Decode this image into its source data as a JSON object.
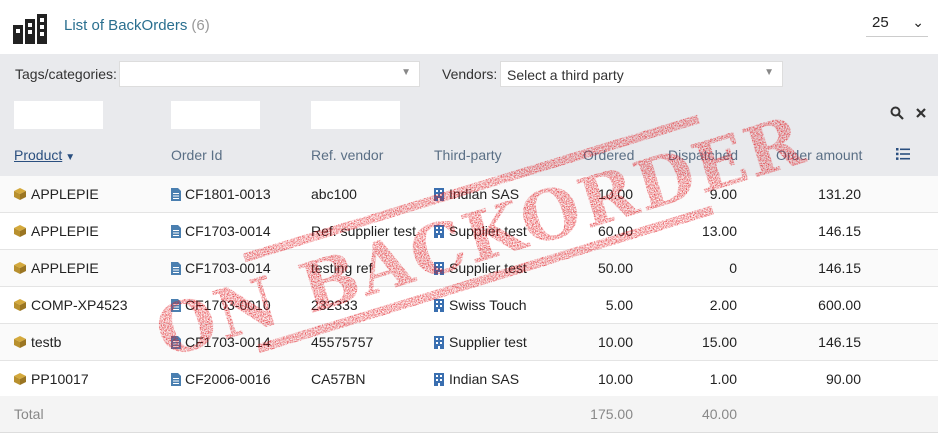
{
  "header": {
    "title": "List of BackOrders",
    "count": "(6)",
    "page_size": "25",
    "icon": "building-icon"
  },
  "filters": {
    "tags_label": "Tags/categories:",
    "tags_value": "",
    "vendors_label": "Vendors:",
    "vendors_placeholder": "Select a third party",
    "search_icon": "search-icon",
    "clear_icon": "close-icon"
  },
  "columns": {
    "product": "Product",
    "order_id": "Order Id",
    "ref_vendor": "Ref. vendor",
    "third_party": "Third-party",
    "ordered": "Ordered",
    "dispatched": "Dispatched",
    "order_amount": "Order amount"
  },
  "rows": [
    {
      "product": "APPLEPIE",
      "order_id": "CF1801-0013",
      "ref": "abc100",
      "third_party": "Indian SAS",
      "ordered": "10.00",
      "dispatched": "9.00",
      "amount": "131.20"
    },
    {
      "product": "APPLEPIE",
      "order_id": "CF1703-0014",
      "ref": "Ref. supplier test",
      "third_party": "Supplier test",
      "ordered": "60.00",
      "dispatched": "13.00",
      "amount": "146.15"
    },
    {
      "product": "APPLEPIE",
      "order_id": "CF1703-0014",
      "ref": "testing ref",
      "third_party": "Supplier test",
      "ordered": "50.00",
      "dispatched": "0",
      "amount": "146.15"
    },
    {
      "product": "COMP-XP4523",
      "order_id": "CF1703-0010",
      "ref": "232333",
      "third_party": "Swiss Touch",
      "ordered": "5.00",
      "dispatched": "2.00",
      "amount": "600.00"
    },
    {
      "product": "testb",
      "order_id": "CF1703-0014",
      "ref": "45575757",
      "third_party": "Supplier test",
      "ordered": "10.00",
      "dispatched": "15.00",
      "amount": "146.15"
    },
    {
      "product": "PP10017",
      "order_id": "CF2006-0016",
      "ref": "CA57BN",
      "third_party": "Indian SAS",
      "ordered": "10.00",
      "dispatched": "1.00",
      "amount": "90.00"
    }
  ],
  "totals": {
    "label": "Total",
    "ordered": "175.00",
    "dispatched": "40.00"
  },
  "stamp": {
    "text": "ON BACKORDER",
    "color": "#e0161c"
  },
  "colors": {
    "accent": "#2a6f8f",
    "filter_bg": "#e9eaed",
    "product_icon": "#b8902e",
    "order_icon": "#4a7fb0",
    "thirdparty_icon": "#3a6fb0"
  }
}
